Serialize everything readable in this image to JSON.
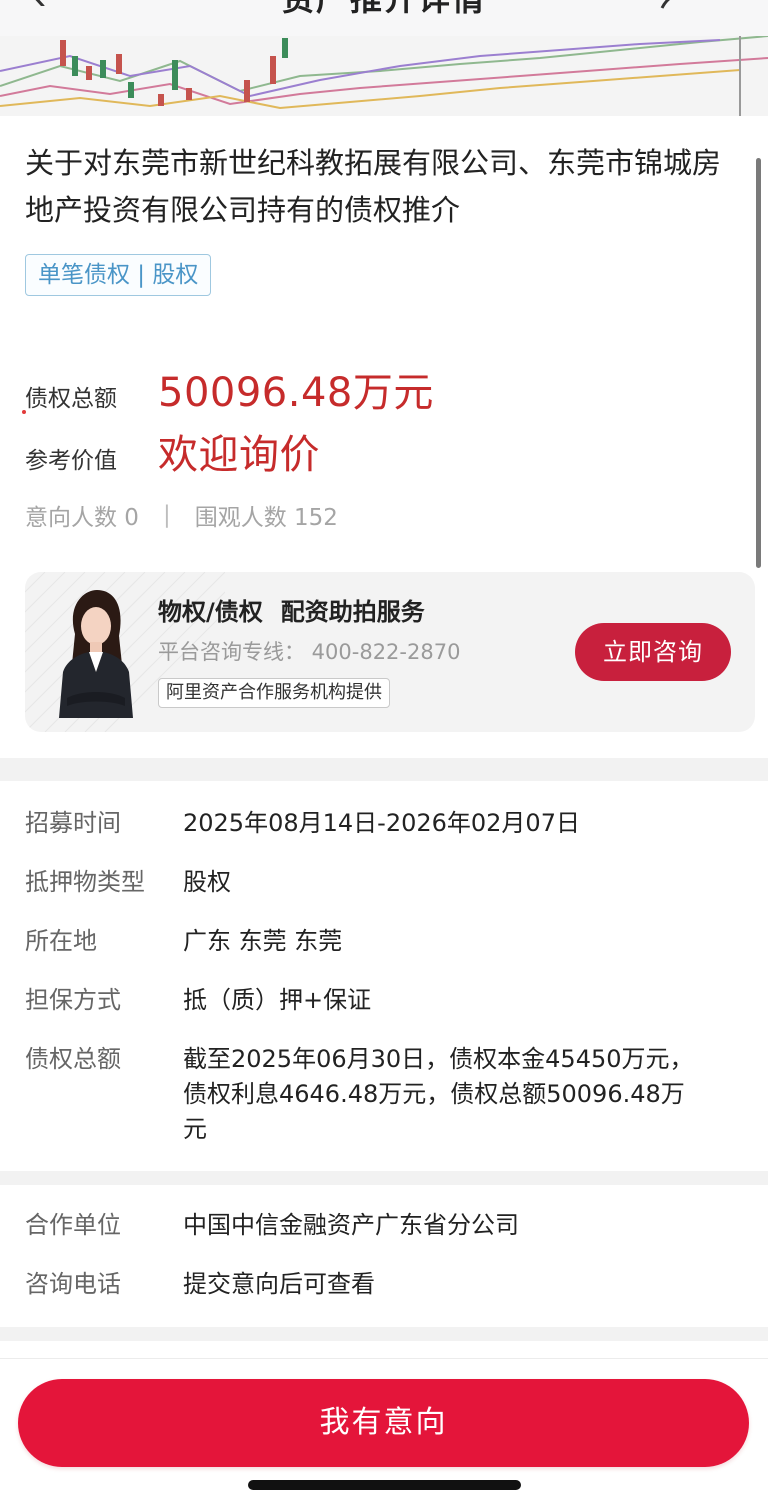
{
  "header": {
    "title": "资产推介详情"
  },
  "asset": {
    "title": "关于对东莞市新世纪科教拓展有限公司、东莞市锦城房地产投资有限公司持有的债权推介",
    "tag": "单笔债权 | 股权",
    "total_label": "债权总额",
    "total_value": "50096.48万元",
    "reference_label": "参考价值",
    "reference_value": "欢迎询价",
    "intent_count_label": "意向人数 0",
    "separator": "|",
    "viewer_count_label": "围观人数 152"
  },
  "service": {
    "title_part1": "物权/债权",
    "title_part2": "配资助拍服务",
    "phone_text": "平台咨询专线：  400-822-2870",
    "provider": "阿里资产合作服务机构提供",
    "button_label": "立即咨询"
  },
  "details": [
    {
      "label": "招募时间",
      "value": "2025年08月14日-2026年02月07日"
    },
    {
      "label": "抵押物类型",
      "value": "股权"
    },
    {
      "label": "所在地",
      "value": "广东 东莞 东莞"
    },
    {
      "label": "担保方式",
      "value": "抵（质）押+保证"
    },
    {
      "label": "债权总额",
      "value": "截至2025年06月30日，债权本金45450万元，债权利息4646.48万元，债权总额50096.48万元"
    }
  ],
  "contact": [
    {
      "label": "合作单位",
      "value": "中国中信金融资产广东省分公司"
    },
    {
      "label": "咨询电话",
      "value": "提交意向后可查看"
    }
  ],
  "bottom": {
    "intent_button": "我有意向"
  },
  "colors": {
    "accent_red": "#c62b2b",
    "button_red": "#e4153a",
    "tag_blue": "#4a95c7"
  }
}
